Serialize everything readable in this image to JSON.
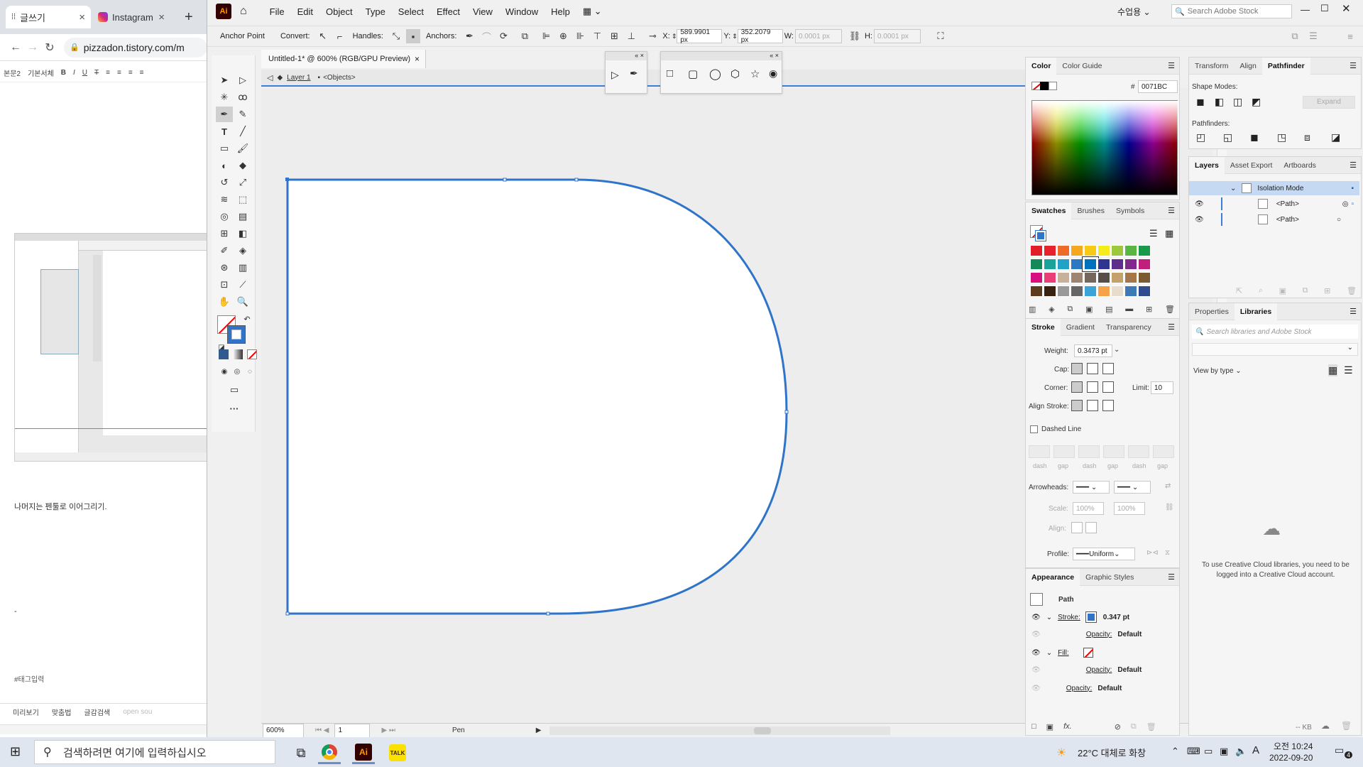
{
  "browser": {
    "tabs": [
      {
        "label": "글쓰기"
      },
      {
        "label": "Instagram"
      }
    ],
    "new_tab": "+",
    "url": "pizzadon.tistory.com/m",
    "editor_toolbar": {
      "paragraph": "본문2",
      "font": "기본서체",
      "bold": "B",
      "italic": "I",
      "underline": "U",
      "strike": "T"
    },
    "text1": "나머지는 펜툴로 이어그리기.",
    "text2": "-",
    "tag": "#태그입력",
    "bottom": {
      "preview": "미리보기",
      "spell": "맞춤법",
      "collab": "글감검색",
      "open": "open sou"
    }
  },
  "ai": {
    "logo": "Ai",
    "menu": [
      "File",
      "Edit",
      "Object",
      "Type",
      "Select",
      "Effect",
      "View",
      "Window",
      "Help"
    ],
    "user": "수업용",
    "stock_search_placeholder": "Search Adobe Stock",
    "control": {
      "mode": "Anchor Point",
      "convert": "Convert:",
      "handles": "Handles:",
      "anchors": "Anchors:",
      "x_label": "X:",
      "x_value": "589.9901 px",
      "y_label": "Y:",
      "y_value": "352.2079 px",
      "w_label": "W:",
      "w_value": "0.0001 px",
      "h_label": "H:",
      "h_value": "0.0001 px"
    },
    "doc_tab": "Untitled-1* @ 600% (RGB/GPU Preview)",
    "breadcrumb": {
      "layer": "Layer 1",
      "objects": "<Objects>"
    },
    "status": {
      "zoom": "600%",
      "artboard": "1",
      "tool": "Pen"
    },
    "color_panel": {
      "tabs": [
        "Color",
        "Color Guide"
      ],
      "hex_label": "#",
      "hex": "0071BC"
    },
    "swatches_panel": {
      "tabs": [
        "Swatches",
        "Brushes",
        "Symbols"
      ]
    },
    "stroke_panel": {
      "tabs": [
        "Stroke",
        "Gradient",
        "Transparency"
      ],
      "weight_label": "Weight:",
      "weight": "0.3473 pt",
      "cap_label": "Cap:",
      "corner_label": "Corner:",
      "limit_label": "Limit:",
      "limit": "10",
      "align_label": "Align Stroke:",
      "dashed": "Dashed Line",
      "dash_labels": [
        "dash",
        "gap",
        "dash",
        "gap",
        "dash",
        "gap"
      ],
      "arrowheads": "Arrowheads:",
      "scale": "Scale:",
      "scale1": "100%",
      "scale2": "100%",
      "align": "Align:",
      "profile": "Profile:",
      "profile_value": "Uniform"
    },
    "appearance_panel": {
      "tabs": [
        "Appearance",
        "Graphic Styles"
      ],
      "title": "Path",
      "stroke_label": "Stroke:",
      "stroke_value": "0.347 pt",
      "opacity1_label": "Opacity:",
      "opacity1": "Default",
      "fill_label": "Fill:",
      "opacity2_label": "Opacity:",
      "opacity2": "Default",
      "opacity3_label": "Opacity:",
      "opacity3": "Default"
    },
    "pathfinder_panel": {
      "tabs": [
        "Transform",
        "Align",
        "Pathfinder"
      ],
      "shape_modes": "Shape Modes:",
      "expand": "Expand",
      "pathfinders": "Pathfinders:"
    },
    "layers_panel": {
      "tabs": [
        "Layers",
        "Asset Export",
        "Artboards"
      ],
      "rows": [
        {
          "name": "Isolation Mode"
        },
        {
          "name": "<Path>"
        },
        {
          "name": "<Path>"
        }
      ]
    },
    "libraries_panel": {
      "tabs": [
        "Properties",
        "Libraries"
      ],
      "search_placeholder": "Search libraries and Adobe Stock",
      "view_by": "View by type",
      "message": "To use Creative Cloud libraries, you need to be logged into a Creative Cloud account.",
      "kb": "-- KB"
    },
    "stroke_color": "#2F74C9"
  },
  "taskbar": {
    "search_placeholder": "검색하려면 여기에 입력하십시오",
    "weather": "22°C 대체로 화창",
    "time": "오전 10:24",
    "date": "2022-09-20",
    "notify_count": "4"
  }
}
